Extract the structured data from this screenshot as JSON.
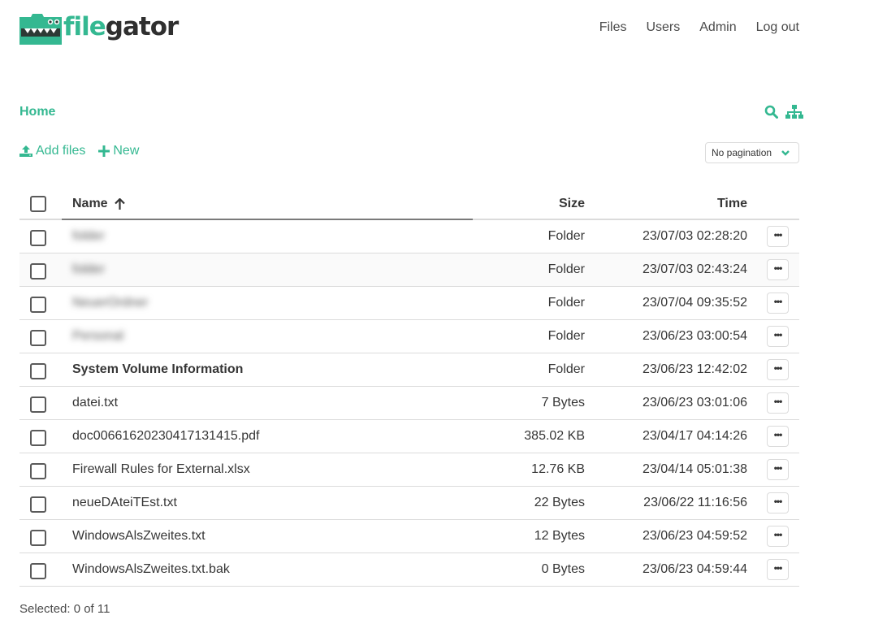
{
  "app": {
    "logo_part1": "file",
    "logo_part2": "gator",
    "accent": "#34b891"
  },
  "nav": {
    "files": "Files",
    "users": "Users",
    "admin": "Admin",
    "logout": "Log out"
  },
  "breadcrumb": {
    "home": "Home"
  },
  "toolbar": {
    "add_files": "Add files",
    "new": "New",
    "pagination": "No pagination",
    "search_icon": "search-icon",
    "tree_icon": "sitemap-icon"
  },
  "table": {
    "headers": {
      "name": "Name",
      "size": "Size",
      "time": "Time",
      "sort_direction": "ascending"
    },
    "rows": [
      {
        "name": "folder",
        "size": "Folder",
        "time": "23/07/03 02:28:20",
        "blurred": true
      },
      {
        "name": "folder",
        "size": "Folder",
        "time": "23/07/03 02:43:24",
        "blurred": true
      },
      {
        "name": "NeuerOrdner",
        "size": "Folder",
        "time": "23/07/04 09:35:52",
        "blurred": true
      },
      {
        "name": "Personal",
        "size": "Folder",
        "time": "23/06/23 03:00:54",
        "blurred": true
      },
      {
        "name": "System Volume Information",
        "size": "Folder",
        "time": "23/06/23 12:42:02",
        "bold": true
      },
      {
        "name": "datei.txt",
        "size": "7 Bytes",
        "time": "23/06/23 03:01:06"
      },
      {
        "name": "doc00661620230417131415.pdf",
        "size": "385.02 KB",
        "time": "23/04/17 04:14:26"
      },
      {
        "name": "Firewall Rules for External.xlsx",
        "size": "12.76 KB",
        "time": "23/04/14 05:01:38"
      },
      {
        "name": "neueDAteiTEst.txt",
        "size": "22 Bytes",
        "time": "23/06/22 11:16:56"
      },
      {
        "name": "WindowsAlsZweites.txt",
        "size": "12 Bytes",
        "time": "23/06/23 04:59:52"
      },
      {
        "name": "WindowsAlsZweites.txt.bak",
        "size": "0 Bytes",
        "time": "23/06/23 04:59:44"
      }
    ]
  },
  "footer": {
    "selected": "Selected: 0 of 11"
  }
}
